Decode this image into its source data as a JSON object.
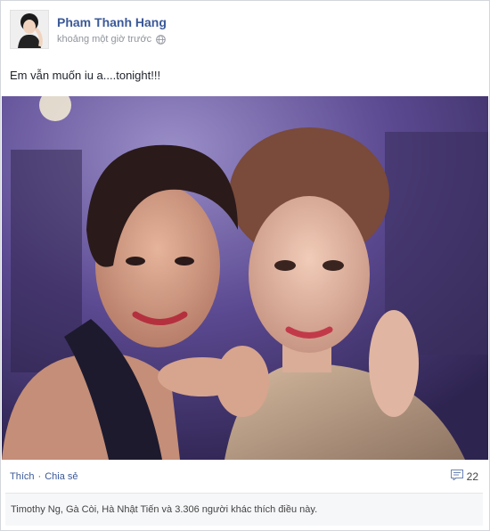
{
  "post": {
    "author": "Pham Thanh Hang",
    "time": "khoảng một giờ trước",
    "message": "Em vẫn muốn iu a....tonight!!!"
  },
  "actions": {
    "like": "Thích",
    "separator": "·",
    "share": "Chia sẻ",
    "comment_count": "22"
  },
  "likes": {
    "text": "Timothy Ng, Gà Còi, Hà Nhật Tiến và 3.306 người khác thích điều này."
  },
  "icons": {
    "privacy": "globe-icon",
    "comments": "comment-icon"
  },
  "colors": {
    "link": "#3b5998",
    "meta": "#90949c"
  }
}
